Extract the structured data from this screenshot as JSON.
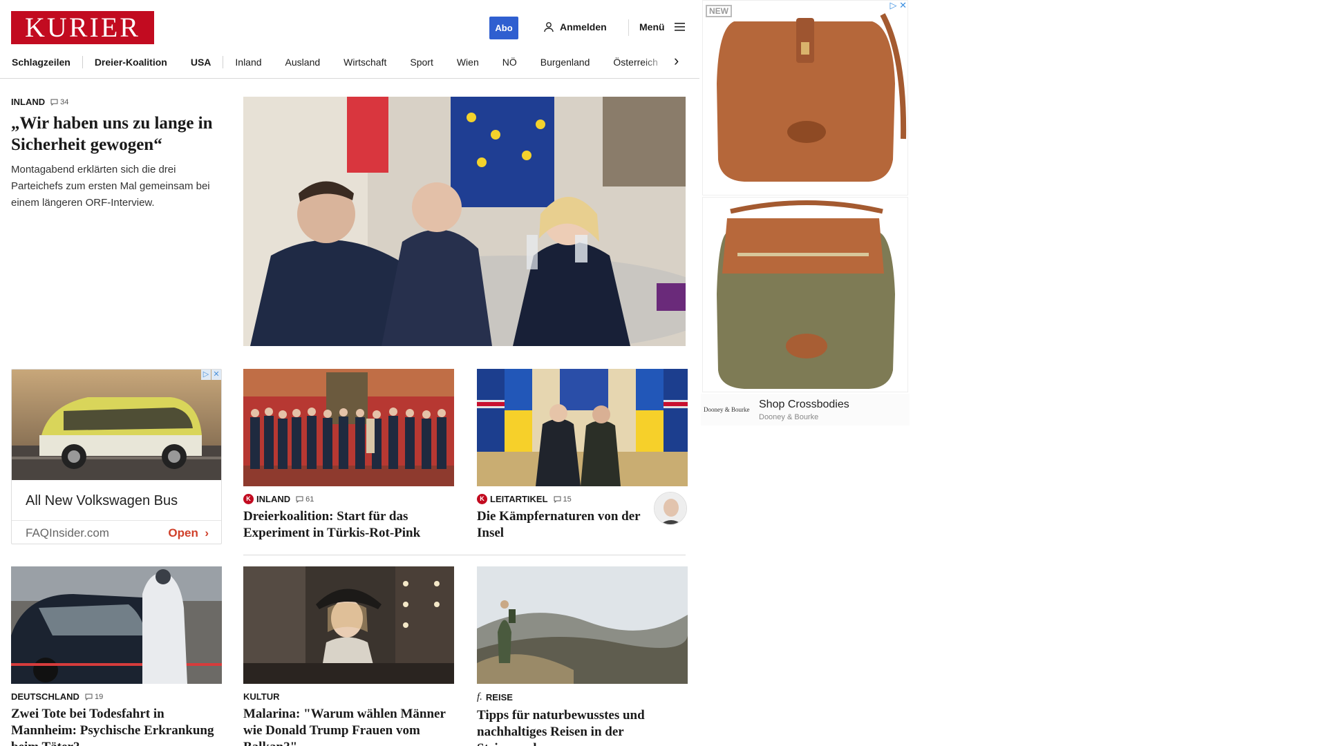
{
  "header": {
    "logo": "KURIER",
    "abo": "Abo",
    "login": "Anmelden",
    "menu": "Menü"
  },
  "nav": {
    "items": [
      "Schlagzeilen",
      "Dreier-Koalition",
      "USA",
      "Inland",
      "Ausland",
      "Wirtschaft",
      "Sport",
      "Wien",
      "NÖ",
      "Burgenland",
      "Österreich"
    ]
  },
  "lead": {
    "kicker": "INLAND",
    "comments": "34",
    "title": "„Wir haben uns zu lange in Sicherheit gewogen“",
    "teaser": "Montagabend erklärten sich die drei Parteichefs zum ersten Mal gemeinsam bei einem längeren ORF-Interview."
  },
  "ad_left": {
    "headline": "All New Volkswagen Bus",
    "source": "FAQInsider.com",
    "cta": "Open"
  },
  "cards": [
    {
      "kicker": "INLAND",
      "comments": "61",
      "title": "Dreierkoalition: Start für das Experiment in Türkis-Rot-Pink"
    },
    {
      "kicker": "LEITARTIKEL",
      "comments": "15",
      "title": "Die Kämpfernaturen von der Insel"
    },
    {
      "kicker": "DEUTSCHLAND",
      "comments": "19",
      "title": "Zwei Tote bei Todesfahrt in Mannheim: Psychische Erkrankung beim Täter?"
    },
    {
      "kicker": "KULTUR",
      "title": "Malarina: \"Warum wählen Männer wie Donald Trump Frauen vom Balkan?\""
    },
    {
      "kicker": "REISE",
      "title": "Tipps für naturbewusstes und nachhaltiges Reisen in der Steiermark"
    }
  ],
  "ad_right": {
    "new_tag": "NEW",
    "brand": "Dooney & Bourke",
    "shop_title": "Shop Crossbodies",
    "shop_sub": "Dooney & Bourke"
  }
}
